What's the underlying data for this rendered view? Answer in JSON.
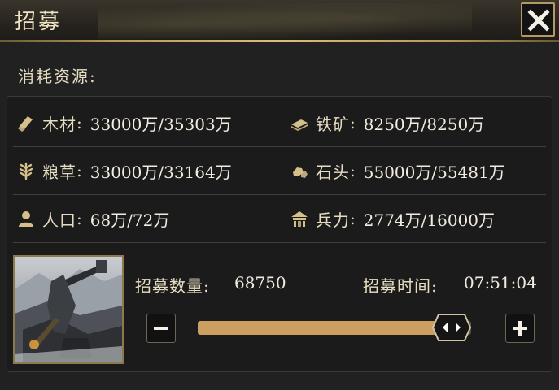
{
  "window": {
    "title": "招募",
    "close_icon": "close-icon"
  },
  "consume": {
    "label": "消耗资源:"
  },
  "colon": ":",
  "resources": [
    {
      "name": "木材",
      "value": "33000万/35303万",
      "icon": "wood-icon"
    },
    {
      "name": "铁矿",
      "value": "8250万/8250万",
      "icon": "iron-ore-icon"
    },
    {
      "name": "粮草",
      "value": "33000万/33164万",
      "icon": "grain-icon"
    },
    {
      "name": "石头",
      "value": "55000万/55481万",
      "icon": "stone-icon"
    },
    {
      "name": "人口",
      "value": "68万/72万",
      "icon": "population-icon"
    },
    {
      "name": "兵力",
      "value": "2774万/16000万",
      "icon": "troops-icon"
    }
  ],
  "recruit": {
    "count_label": "招募数量:",
    "count_value": "68750",
    "time_label": "招募时间:",
    "time_value": "07:51:04",
    "slider_fraction": 0.93
  },
  "colors": {
    "accent_gold": "#b39a62",
    "slider_fill": "#cd9e62",
    "icon_gold": "#d6c08a"
  }
}
